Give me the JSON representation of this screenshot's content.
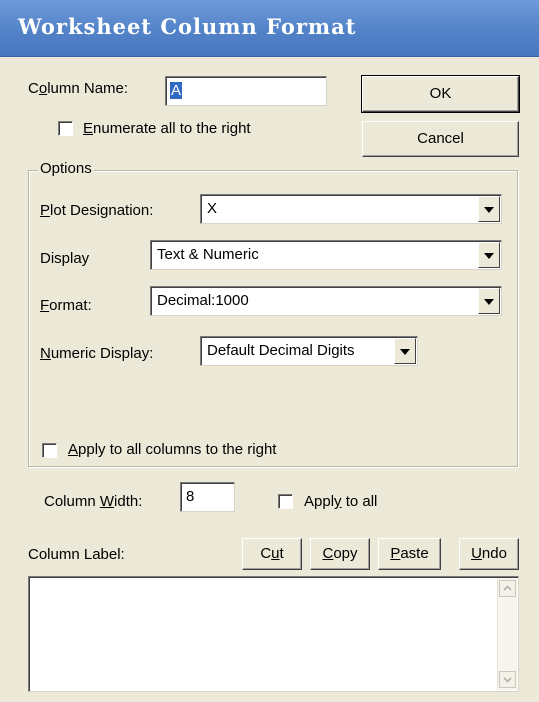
{
  "window": {
    "title": "Worksheet Column Format"
  },
  "column_name": {
    "label_pre": "C",
    "label_ul": "o",
    "label_post": "lumn Name:",
    "value": "A"
  },
  "enumerate": {
    "label_ul": "E",
    "label_post": "numerate all to the right",
    "checked": false
  },
  "buttons": {
    "ok": "OK",
    "cancel": "Cancel"
  },
  "options": {
    "legend": "Options",
    "plot_designation": {
      "label_ul": "P",
      "label_post": "lot Designation:",
      "value": "X"
    },
    "display": {
      "label": "Display",
      "value": "Text & Numeric"
    },
    "format": {
      "label_ul": "F",
      "label_post": "ormat:",
      "value": "Decimal:1000"
    },
    "numeric_display": {
      "label_ul": "N",
      "label_post": "umeric Display:",
      "value": "Default Decimal Digits"
    },
    "apply_columns_right": {
      "label_ul": "A",
      "label_post": "pply to all columns to the right",
      "checked": false
    }
  },
  "column_width": {
    "label_pre": "Column ",
    "label_ul": "W",
    "label_post": "idth:",
    "value": "8"
  },
  "apply_to_all": {
    "label_pre": "Appl",
    "label_ul": "y",
    "label_post": " to all",
    "checked": false
  },
  "column_label": {
    "label": "Column Label:",
    "cut": {
      "pre": "C",
      "ul": "u",
      "post": "t"
    },
    "copy": {
      "pre": "",
      "ul": "C",
      "post": "opy"
    },
    "paste": {
      "pre": "",
      "ul": "P",
      "post": "aste"
    },
    "undo": {
      "pre": "",
      "ul": "U",
      "post": "ndo"
    },
    "value": ""
  },
  "icons": {
    "dropdown": "chevron-down-icon",
    "scroll_up": "scroll-up-icon",
    "scroll_down": "scroll-down-icon"
  }
}
